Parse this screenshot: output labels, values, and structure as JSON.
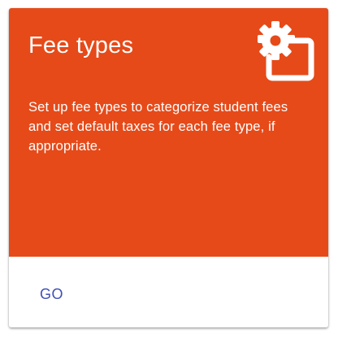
{
  "card": {
    "title": "Fee types",
    "description": "Set up fee types to categorize student fees and set default taxes for each fee type, if appropriate.",
    "icon": "settings-gear-icon",
    "action_label": "GO"
  },
  "colors": {
    "hero_background": "#e64a19",
    "action_text": "#3f51b5",
    "hero_text": "#ffffff"
  }
}
